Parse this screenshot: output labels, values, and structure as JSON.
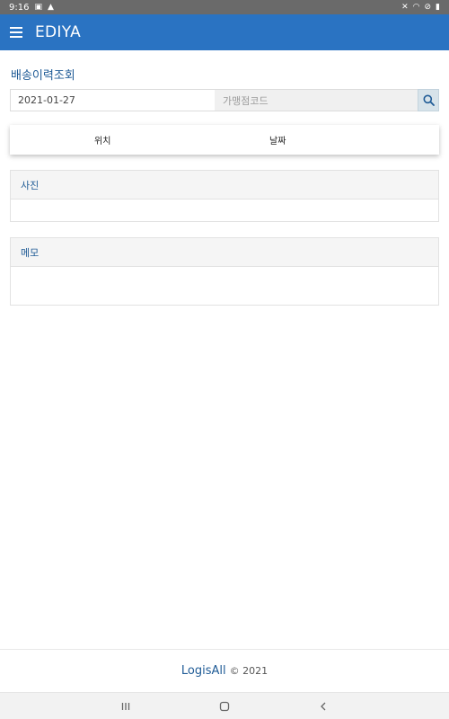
{
  "status_bar": {
    "time": "9:16"
  },
  "app_bar": {
    "title": "EDIYA"
  },
  "page": {
    "title": "배송이력조회"
  },
  "search": {
    "date_value": "2021-01-27",
    "store_code_placeholder": "가맹점코드"
  },
  "tabs": [
    {
      "label": "위치"
    },
    {
      "label": "날짜"
    }
  ],
  "panels": {
    "photo_title": "사진",
    "memo_title": "메모"
  },
  "footer": {
    "brand": "LogisAll",
    "copyright": "© 2021"
  },
  "colors": {
    "app_bar": "#2a73c2",
    "accent_text": "#1f5b96",
    "status_bar": "#6a6a6a"
  },
  "icons": {
    "menu": "hamburger-icon",
    "search": "search-icon",
    "nav_recent": "recent-apps-icon",
    "nav_home": "home-icon",
    "nav_back": "back-icon"
  }
}
